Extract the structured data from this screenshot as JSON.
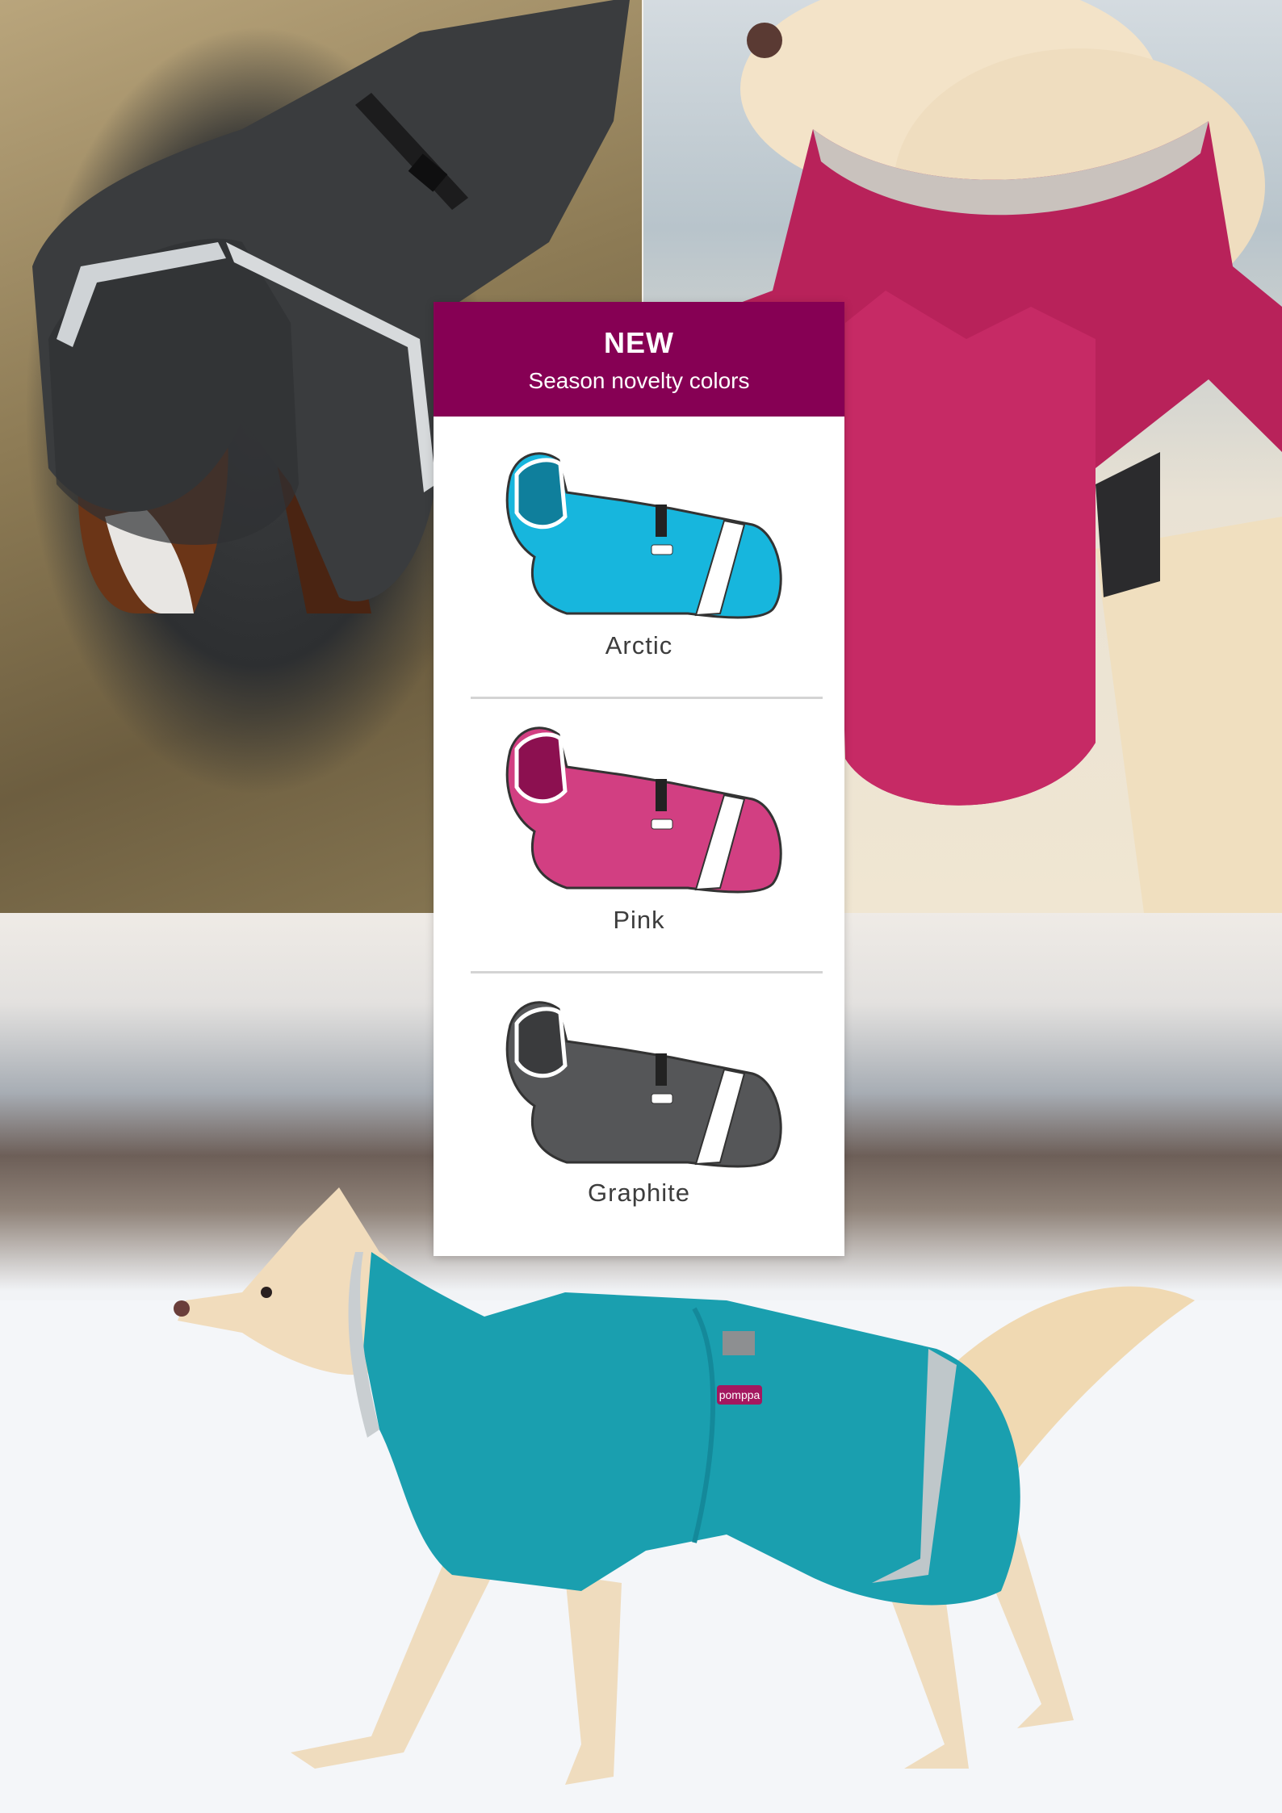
{
  "card": {
    "title": "NEW",
    "subtitle": "Season novelty colors",
    "header_color": "#860054"
  },
  "swatches": [
    {
      "label": "Arctic",
      "color": "#17b6dd",
      "icon": "coat-arctic-icon"
    },
    {
      "label": "Pink",
      "color": "#d23f82",
      "icon": "coat-pink-icon"
    },
    {
      "label": "Graphite",
      "color": "#555658",
      "icon": "coat-graphite-icon"
    }
  ],
  "photos": {
    "top_left": "dog-in-graphite-coat-photo",
    "top_right": "dog-in-pink-coat-photo",
    "bottom": "dog-in-teal-coat-photo"
  },
  "brand_tag": "pomppa"
}
